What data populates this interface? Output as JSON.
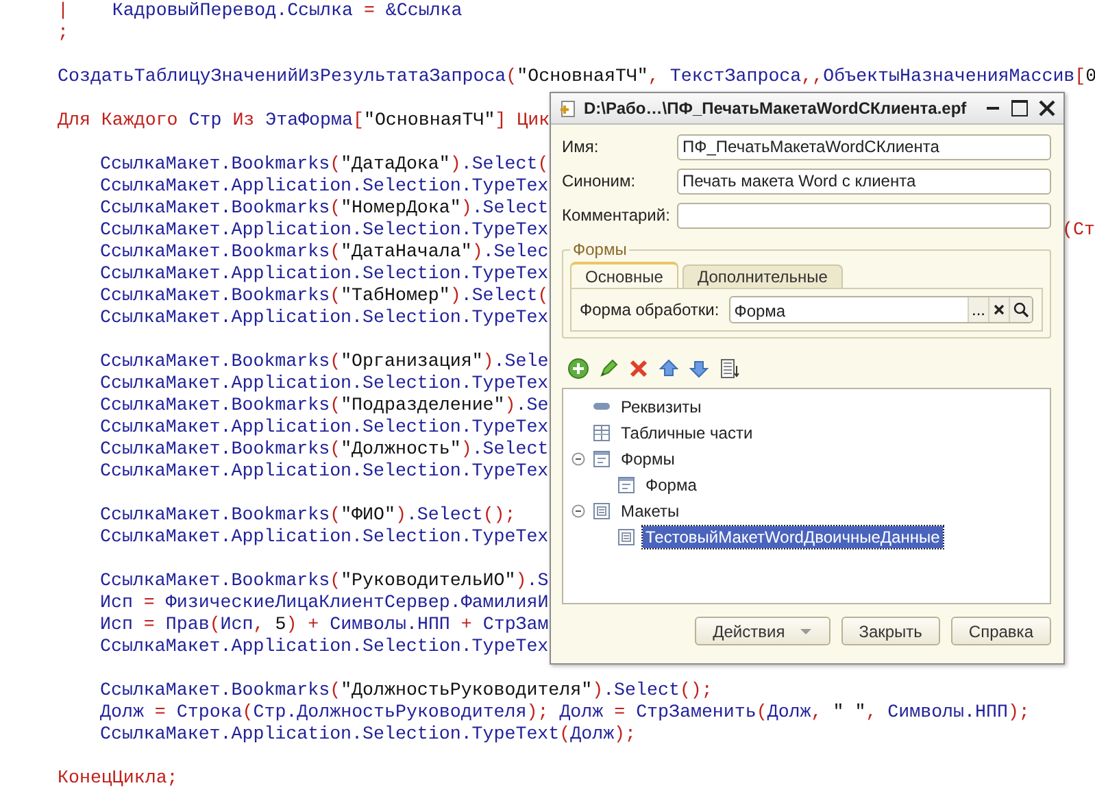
{
  "code": [
    [
      {
        "tokens": [
          {
            "kind": "p",
            "text": "|"
          },
          {
            "kind": "i",
            "text": "    КадровыйПеревод.Ссылка "
          },
          {
            "kind": "p",
            "text": "= "
          },
          {
            "kind": "i",
            "text": "&Ссылка"
          }
        ]
      },
      {
        "tokens": [
          {
            "kind": "p",
            "text": ";"
          }
        ]
      }
    ],
    [
      {
        "tokens": [
          {
            "kind": "i",
            "text": "СоздатьТаблицуЗначенийИзРезультатаЗапроса"
          },
          {
            "kind": "p",
            "text": "("
          },
          {
            "kind": "s",
            "text": "\"ОсновнаяТЧ\""
          },
          {
            "kind": "p",
            "text": ", "
          },
          {
            "kind": "i",
            "text": "ТекстЗапроса"
          },
          {
            "kind": "p",
            "text": ",,"
          },
          {
            "kind": "i",
            "text": "ОбъектыНазначенияМассив"
          },
          {
            "kind": "p",
            "text": "["
          },
          {
            "kind": "n",
            "text": "0"
          }
        ]
      }
    ],
    [
      {
        "tokens": [
          {
            "kind": "k",
            "text": "Для Каждого "
          },
          {
            "kind": "i",
            "text": "Стр "
          },
          {
            "kind": "k",
            "text": "Из "
          },
          {
            "kind": "i",
            "text": "ЭтаФорма"
          },
          {
            "kind": "p",
            "text": "["
          },
          {
            "kind": "s",
            "text": "\"ОсновнаяТЧ\""
          },
          {
            "kind": "p",
            "text": "] "
          },
          {
            "kind": "k",
            "text": "Цик"
          }
        ],
        "children": [
          [
            {
              "tokens": [
                {
                  "kind": "i",
                  "text": "СсылкаМакет.Bookmarks"
                },
                {
                  "kind": "p",
                  "text": "("
                },
                {
                  "kind": "s",
                  "text": "\"ДатаДока\""
                },
                {
                  "kind": "p",
                  "text": ")"
                },
                {
                  "kind": "i",
                  "text": ".Select"
                },
                {
                  "kind": "p",
                  "text": "("
                }
              ]
            },
            {
              "tokens": [
                {
                  "kind": "i",
                  "text": "СсылкаМакет.Application.Selection.TypeTex"
                }
              ]
            },
            {
              "tokens": [
                {
                  "kind": "i",
                  "text": "СсылкаМакет.Bookmarks"
                },
                {
                  "kind": "p",
                  "text": "("
                },
                {
                  "kind": "s",
                  "text": "\"НомерДока\""
                },
                {
                  "kind": "p",
                  "text": ")"
                },
                {
                  "kind": "i",
                  "text": ".Select"
                }
              ]
            },
            {
              "tokens": [
                {
                  "kind": "i",
                  "text": "СсылкаМакет.Application.Selection.TypeTex"
                }
              ],
              "tail": [
                {
                  "kind": "p",
                  "text": "(Ст"
                }
              ]
            },
            {
              "tokens": [
                {
                  "kind": "i",
                  "text": "СсылкаМакет.Bookmarks"
                },
                {
                  "kind": "p",
                  "text": "("
                },
                {
                  "kind": "s",
                  "text": "\"ДатаНачала\""
                },
                {
                  "kind": "p",
                  "text": ")"
                },
                {
                  "kind": "i",
                  "text": ".Selec"
                }
              ]
            },
            {
              "tokens": [
                {
                  "kind": "i",
                  "text": "СсылкаМакет.Application.Selection.TypeTex"
                }
              ]
            },
            {
              "tokens": [
                {
                  "kind": "i",
                  "text": "СсылкаМакет.Bookmarks"
                },
                {
                  "kind": "p",
                  "text": "("
                },
                {
                  "kind": "s",
                  "text": "\"ТабНомер\""
                },
                {
                  "kind": "p",
                  "text": ")"
                },
                {
                  "kind": "i",
                  "text": ".Select"
                },
                {
                  "kind": "p",
                  "text": "("
                }
              ]
            },
            {
              "tokens": [
                {
                  "kind": "i",
                  "text": "СсылкаМакет.Application.Selection.TypeTex"
                }
              ]
            }
          ],
          [
            {
              "tokens": [
                {
                  "kind": "i",
                  "text": "СсылкаМакет.Bookmarks"
                },
                {
                  "kind": "p",
                  "text": "("
                },
                {
                  "kind": "s",
                  "text": "\"Организация\""
                },
                {
                  "kind": "p",
                  "text": ")"
                },
                {
                  "kind": "i",
                  "text": ".Sele"
                }
              ]
            },
            {
              "tokens": [
                {
                  "kind": "i",
                  "text": "СсылкаМакет.Application.Selection.TypeTex"
                }
              ]
            },
            {
              "tokens": [
                {
                  "kind": "i",
                  "text": "СсылкаМакет.Bookmarks"
                },
                {
                  "kind": "p",
                  "text": "("
                },
                {
                  "kind": "s",
                  "text": "\"Подразделение\""
                },
                {
                  "kind": "p",
                  "text": ")"
                },
                {
                  "kind": "i",
                  "text": ".Se"
                }
              ]
            },
            {
              "tokens": [
                {
                  "kind": "i",
                  "text": "СсылкаМакет.Application.Selection.TypeTex"
                }
              ]
            },
            {
              "tokens": [
                {
                  "kind": "i",
                  "text": "СсылкаМакет.Bookmarks"
                },
                {
                  "kind": "p",
                  "text": "("
                },
                {
                  "kind": "s",
                  "text": "\"Должность\""
                },
                {
                  "kind": "p",
                  "text": ")"
                },
                {
                  "kind": "i",
                  "text": ".Select"
                }
              ]
            },
            {
              "tokens": [
                {
                  "kind": "i",
                  "text": "СсылкаМакет.Application.Selection.TypeTex"
                }
              ]
            }
          ],
          [
            {
              "tokens": [
                {
                  "kind": "i",
                  "text": "СсылкаМакет.Bookmarks"
                },
                {
                  "kind": "p",
                  "text": "("
                },
                {
                  "kind": "s",
                  "text": "\"ФИО\""
                },
                {
                  "kind": "p",
                  "text": ")"
                },
                {
                  "kind": "i",
                  "text": ".Select"
                },
                {
                  "kind": "p",
                  "text": "();"
                }
              ]
            },
            {
              "tokens": [
                {
                  "kind": "i",
                  "text": "СсылкаМакет.Application.Selection.TypeTex"
                }
              ]
            }
          ],
          [
            {
              "tokens": [
                {
                  "kind": "i",
                  "text": "СсылкаМакет.Bookmarks"
                },
                {
                  "kind": "p",
                  "text": "("
                },
                {
                  "kind": "s",
                  "text": "\"РуководительИО\""
                },
                {
                  "kind": "p",
                  "text": ")"
                },
                {
                  "kind": "i",
                  "text": ".S"
                }
              ]
            },
            {
              "tokens": [
                {
                  "kind": "i",
                  "text": "Исп "
                },
                {
                  "kind": "p",
                  "text": "= "
                },
                {
                  "kind": "i",
                  "text": "ФизическиеЛицаКлиентСервер.ФамилияИ"
                }
              ]
            },
            {
              "tokens": [
                {
                  "kind": "i",
                  "text": "Исп "
                },
                {
                  "kind": "p",
                  "text": "= "
                },
                {
                  "kind": "i",
                  "text": "Прав"
                },
                {
                  "kind": "p",
                  "text": "("
                },
                {
                  "kind": "i",
                  "text": "Исп"
                },
                {
                  "kind": "p",
                  "text": ", "
                },
                {
                  "kind": "n",
                  "text": "5"
                },
                {
                  "kind": "p",
                  "text": ") + "
                },
                {
                  "kind": "i",
                  "text": "Символы.НПП "
                },
                {
                  "kind": "p",
                  "text": "+ "
                },
                {
                  "kind": "i",
                  "text": "СтрЗам"
                }
              ]
            },
            {
              "tokens": [
                {
                  "kind": "i",
                  "text": "СсылкаМакет.Application.Selection.TypeTex"
                }
              ]
            }
          ],
          [
            {
              "tokens": [
                {
                  "kind": "i",
                  "text": "СсылкаМакет.Bookmarks"
                },
                {
                  "kind": "p",
                  "text": "("
                },
                {
                  "kind": "s",
                  "text": "\"ДолжностьРуководителя\""
                },
                {
                  "kind": "p",
                  "text": ")"
                },
                {
                  "kind": "i",
                  "text": ".Select"
                },
                {
                  "kind": "p",
                  "text": "();"
                }
              ]
            },
            {
              "tokens": [
                {
                  "kind": "i",
                  "text": "Долж "
                },
                {
                  "kind": "p",
                  "text": "= "
                },
                {
                  "kind": "i",
                  "text": "Строка"
                },
                {
                  "kind": "p",
                  "text": "("
                },
                {
                  "kind": "i",
                  "text": "Стр.ДолжностьРуководителя"
                },
                {
                  "kind": "p",
                  "text": "); "
                },
                {
                  "kind": "i",
                  "text": "Долж "
                },
                {
                  "kind": "p",
                  "text": "= "
                },
                {
                  "kind": "i",
                  "text": "СтрЗаменить"
                },
                {
                  "kind": "p",
                  "text": "("
                },
                {
                  "kind": "i",
                  "text": "Долж"
                },
                {
                  "kind": "p",
                  "text": ", "
                },
                {
                  "kind": "s",
                  "text": "\" \""
                },
                {
                  "kind": "p",
                  "text": ", "
                },
                {
                  "kind": "i",
                  "text": "Символы.НПП"
                },
                {
                  "kind": "p",
                  "text": ");"
                }
              ]
            },
            {
              "tokens": [
                {
                  "kind": "i",
                  "text": "СсылкаМакет.Application.Selection.TypeText"
                },
                {
                  "kind": "p",
                  "text": "("
                },
                {
                  "kind": "i",
                  "text": "Долж"
                },
                {
                  "kind": "p",
                  "text": ");"
                }
              ]
            }
          ]
        ]
      }
    ],
    [
      {
        "tokens": [
          {
            "kind": "k",
            "text": "КонецЦикла"
          },
          {
            "kind": "p",
            "text": ";"
          }
        ]
      }
    ]
  ],
  "dialog": {
    "title": "D:\\Рабо…\\ПФ_ПечатьМакетаWordСКлиента.epf",
    "fields": [
      {
        "label": "Имя:",
        "value": "ПФ_ПечатьМакетаWordСКлиента"
      },
      {
        "label": "Синоним:",
        "value": "Печать макета Word с клиента"
      },
      {
        "label": "Комментарий:"
      }
    ],
    "group": {
      "title": "Формы",
      "tabs": [
        {
          "label": "Основные",
          "selected": true
        },
        {
          "label": "Дополнительные",
          "selected": false
        }
      ],
      "field": {
        "label": "Форма обработки:",
        "value": "Форма",
        "choice": "..."
      }
    },
    "tree": [
      {
        "label": "Реквизиты",
        "kind": "attribute",
        "selected": false
      },
      {
        "label": "Табличные части",
        "kind": "table",
        "selected": false
      },
      {
        "label": "Формы",
        "kind": "form",
        "selected": false,
        "expanded": true,
        "children": [
          {
            "label": "Форма",
            "kind": "form",
            "selected": false
          }
        ]
      },
      {
        "label": "Макеты",
        "kind": "template",
        "selected": false,
        "expanded": true,
        "children": [
          {
            "label": "ТестовыйМакетWordДвоичныеДанные",
            "kind": "template",
            "selected": true
          }
        ]
      }
    ],
    "buttons": [
      {
        "label": "Действия",
        "kind": "menu"
      },
      {
        "label": "Закрыть",
        "kind": "plain"
      },
      {
        "label": "Справка",
        "kind": "plain"
      }
    ]
  }
}
